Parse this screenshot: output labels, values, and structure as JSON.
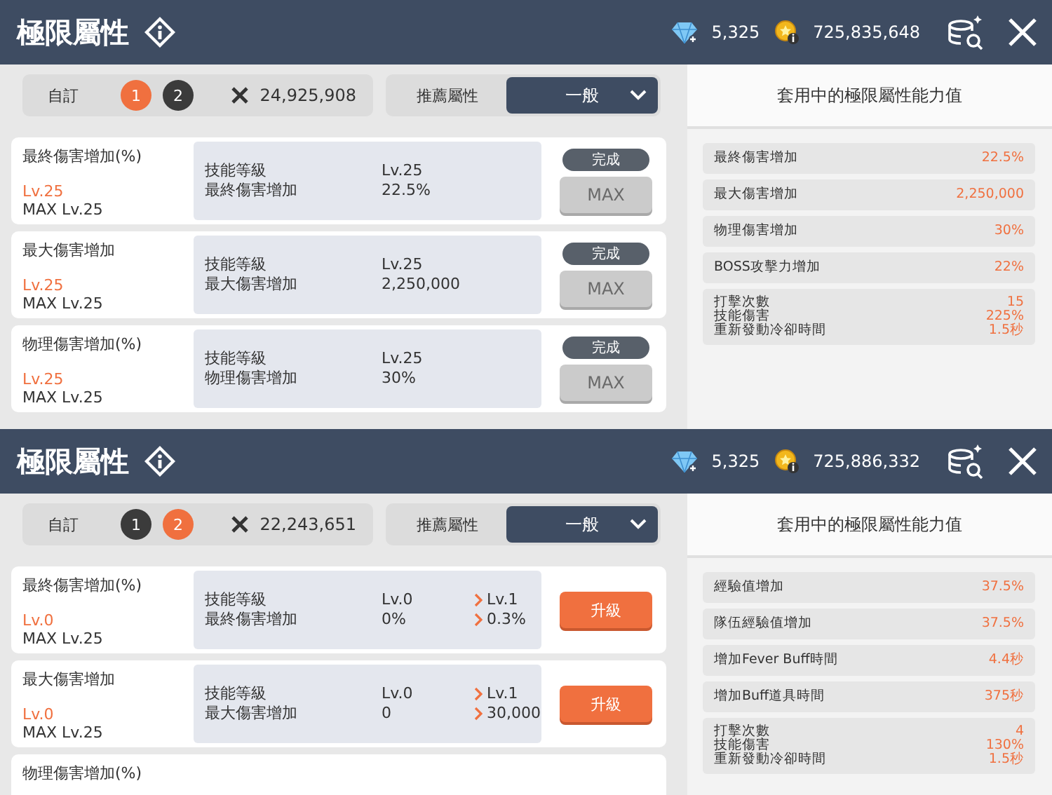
{
  "panels": [
    {
      "header": {
        "title": "極限屬性",
        "gems": "5,325",
        "gold": "725,835,648"
      },
      "toolbar": {
        "preset_label": "自訂",
        "presets": [
          {
            "label": "1",
            "selected": true
          },
          {
            "label": "2",
            "selected": false
          }
        ],
        "power": "24,925,908",
        "recommend_label": "推薦屬性",
        "dropdown": "一般"
      },
      "cards": [
        {
          "kind": "maxed",
          "title": "最終傷害增加(%)",
          "level": "Lv.25",
          "max_level": "MAX Lv.25",
          "info": [
            {
              "label": "技能等級",
              "value": "Lv.25"
            },
            {
              "label": "最終傷害增加",
              "value": "22.5%"
            }
          ],
          "badge": "完成",
          "button": "MAX"
        },
        {
          "kind": "maxed",
          "title": "最大傷害增加",
          "level": "Lv.25",
          "max_level": "MAX Lv.25",
          "info": [
            {
              "label": "技能等級",
              "value": "Lv.25"
            },
            {
              "label": "最大傷害增加",
              "value": "2,250,000"
            }
          ],
          "badge": "完成",
          "button": "MAX"
        },
        {
          "kind": "maxed",
          "title": "物理傷害增加(%)",
          "level": "Lv.25",
          "max_level": "MAX Lv.25",
          "info": [
            {
              "label": "技能等級",
              "value": "Lv.25"
            },
            {
              "label": "物理傷害增加",
              "value": "30%"
            }
          ],
          "badge": "完成",
          "button": "MAX"
        }
      ],
      "stats": {
        "title": "套用中的極限屬性能力值",
        "rows": [
          {
            "kind": "single",
            "label": "最終傷害增加",
            "value": "22.5%"
          },
          {
            "kind": "single",
            "label": "最大傷害增加",
            "value": "2,250,000"
          },
          {
            "kind": "single",
            "label": "物理傷害增加",
            "value": "30%"
          },
          {
            "kind": "single",
            "label": "BOSS攻擊力增加",
            "value": "22%"
          },
          {
            "kind": "multi",
            "labels": [
              "打擊次數",
              "技能傷害",
              "重新發動冷卻時間"
            ],
            "values": [
              "15",
              "225%",
              "1.5秒"
            ]
          }
        ]
      }
    },
    {
      "header": {
        "title": "極限屬性",
        "gems": "5,325",
        "gold": "725,886,332"
      },
      "toolbar": {
        "preset_label": "自訂",
        "presets": [
          {
            "label": "1",
            "selected": false
          },
          {
            "label": "2",
            "selected": true
          }
        ],
        "power": "22,243,651",
        "recommend_label": "推薦屬性",
        "dropdown": "一般"
      },
      "cards": [
        {
          "kind": "upgrade",
          "title": "最終傷害增加(%)",
          "level": "Lv.0",
          "max_level": "MAX Lv.25",
          "info": [
            {
              "label": "技能等級",
              "value": "Lv.0",
              "next": "Lv.1"
            },
            {
              "label": "最終傷害增加",
              "value": "0%",
              "next": "0.3%"
            }
          ],
          "button": "升級"
        },
        {
          "kind": "upgrade",
          "title": "最大傷害增加",
          "level": "Lv.0",
          "max_level": "MAX Lv.25",
          "info": [
            {
              "label": "技能等級",
              "value": "Lv.0",
              "next": "Lv.1"
            },
            {
              "label": "最大傷害增加",
              "value": "0",
              "next": "30,000"
            }
          ],
          "button": "升級"
        },
        {
          "kind": "stub",
          "title": "物理傷害增加(%)"
        }
      ],
      "stats": {
        "title": "套用中的極限屬性能力值",
        "rows": [
          {
            "kind": "single",
            "label": "經驗值增加",
            "value": "37.5%"
          },
          {
            "kind": "single",
            "label": "隊伍經驗值增加",
            "value": "37.5%"
          },
          {
            "kind": "single",
            "label": "增加Fever Buff時間",
            "value": "4.4秒"
          },
          {
            "kind": "single",
            "label": "增加Buff道具時間",
            "value": "375秒"
          },
          {
            "kind": "multi",
            "labels": [
              "打擊次數",
              "技能傷害",
              "重新發動冷卻時間"
            ],
            "values": [
              "4",
              "130%",
              "1.5秒"
            ]
          }
        ]
      }
    }
  ]
}
